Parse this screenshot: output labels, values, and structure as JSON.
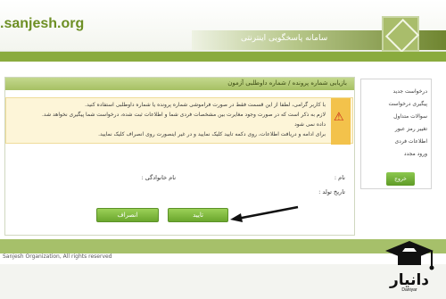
{
  "header": {
    "site_url": ".sanjesh.org",
    "system_title": "سامانه پاسخگویی اینترنتی"
  },
  "panel": {
    "title": "بازیابی شماره پرونده / شماره داوطلبی آزمون",
    "warnings": [
      "با کاربر گرامی، لطفا از این قسمت فقط در صورت فراموشی شماره پرونده یا شماره داوطلبی استفاده کنید.",
      "لازم به ذکر است که در صورت وجود مغایرت بین مشخصات فردی شما و اطلاعات ثبت شده، درخواست شما پیگیری نخواهد شد.",
      "داده نمی شود",
      "برای ادامه و دریافت اطلاعات، روی دکمه تایید کلیک نمایید و در غیر اینصورت روی انصراف کلیک نمایید."
    ],
    "fields": {
      "name_label": "نام :",
      "family_label": "نام خانوادگی :",
      "birth_label": "تاریخ تولد :"
    },
    "buttons": {
      "confirm": "تایید",
      "cancel": "انصراف"
    }
  },
  "sidebar": {
    "items": [
      "درخواست جدید",
      "پیگیری درخواست",
      "سوالات متداول",
      "تغییر رمز عبور",
      "اطلاعات فردی",
      "ورود مجدد"
    ],
    "exit_button": "خروج"
  },
  "footer": {
    "copyright": "Sanjesh Organization, All rights reserved"
  },
  "watermark": {
    "brand": "دانیار",
    "sub": "Daniyar"
  }
}
